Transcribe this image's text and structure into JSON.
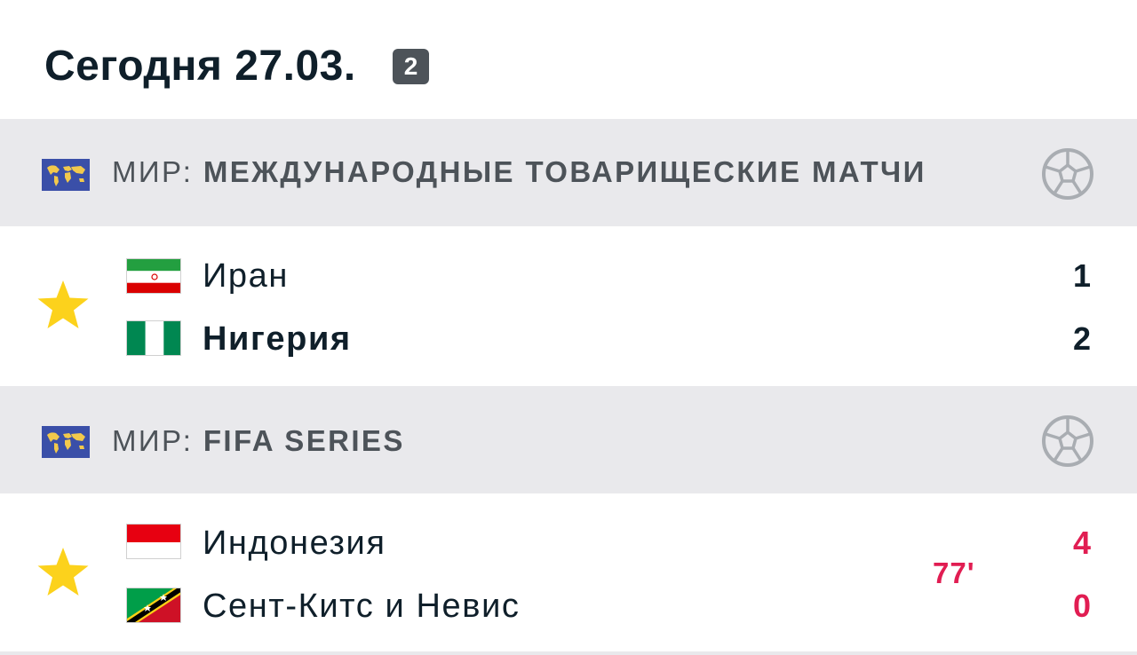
{
  "header": {
    "title": "Сегодня 27.03.",
    "count_badge": "2"
  },
  "leagues": [
    {
      "country": "МИР:",
      "competition": "МЕЖДУНАРОДНЫЕ ТОВАРИЩЕСКИЕ МАТЧИ",
      "flag_icon": "world-map-icon",
      "sport_icon": "soccer-ball-icon",
      "match": {
        "favorite_icon": "star-icon",
        "home": {
          "name": "Иран",
          "flag_icon": "iran-flag-icon",
          "score": "1",
          "bold": false
        },
        "away": {
          "name": "Нигерия",
          "flag_icon": "nigeria-flag-icon",
          "score": "2",
          "bold": true
        },
        "status": ""
      }
    },
    {
      "country": "МИР:",
      "competition": "FIFA SERIES",
      "flag_icon": "world-map-icon",
      "sport_icon": "soccer-ball-icon",
      "match": {
        "favorite_icon": "star-icon",
        "home": {
          "name": "Индонезия",
          "flag_icon": "indonesia-flag-icon",
          "score": "4",
          "bold": false
        },
        "away": {
          "name": "Сент-Китс и Невис",
          "flag_icon": "saint-kitts-nevis-flag-icon",
          "score": "0",
          "bold": false
        },
        "status": "77'"
      }
    }
  ],
  "colors": {
    "live": "#e11d52",
    "star": "#fcd21c",
    "league_bg": "#e9e9ec",
    "text_dark": "#0f1f2a",
    "text_muted": "#4d5359"
  }
}
